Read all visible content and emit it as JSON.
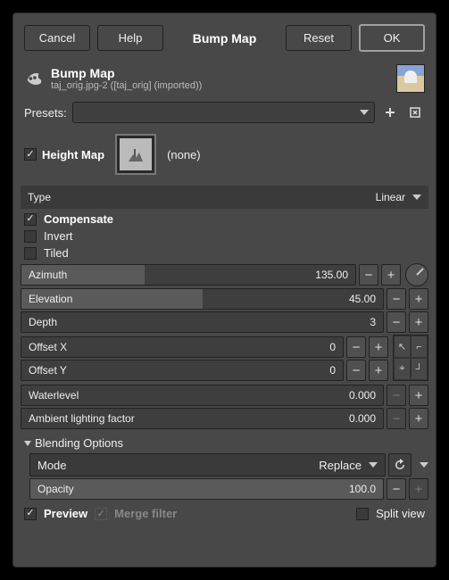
{
  "buttons": {
    "cancel": "Cancel",
    "help": "Help",
    "reset": "Reset",
    "ok": "OK"
  },
  "title": "Bump Map",
  "header": {
    "title": "Bump Map",
    "subtitle": "taj_orig.jpg-2 ([taj_orig] (imported))"
  },
  "presets_label": "Presets:",
  "height_map": {
    "label": "Height Map",
    "value": "(none)"
  },
  "type": {
    "label": "Type",
    "value": "Linear"
  },
  "checks": {
    "compensate": "Compensate",
    "invert": "Invert",
    "tiled": "Tiled"
  },
  "sliders": {
    "azimuth": {
      "label": "Azimuth",
      "value": "135.00",
      "fill": 37
    },
    "elevation": {
      "label": "Elevation",
      "value": "45.00",
      "fill": 50
    },
    "depth": {
      "label": "Depth",
      "value": "3",
      "fill": 0
    },
    "offsetx": {
      "label": "Offset X",
      "value": "0",
      "fill": 0
    },
    "offsety": {
      "label": "Offset Y",
      "value": "0",
      "fill": 0
    },
    "water": {
      "label": "Waterlevel",
      "value": "0.000",
      "fill": 0
    },
    "ambient": {
      "label": "Ambient lighting factor",
      "value": "0.000",
      "fill": 0
    },
    "opacity": {
      "label": "Opacity",
      "value": "100.0",
      "fill": 100
    }
  },
  "blending": {
    "section": "Blending Options",
    "mode_label": "Mode",
    "mode_value": "Replace"
  },
  "footer": {
    "preview": "Preview",
    "merge": "Merge filter",
    "split": "Split view"
  }
}
